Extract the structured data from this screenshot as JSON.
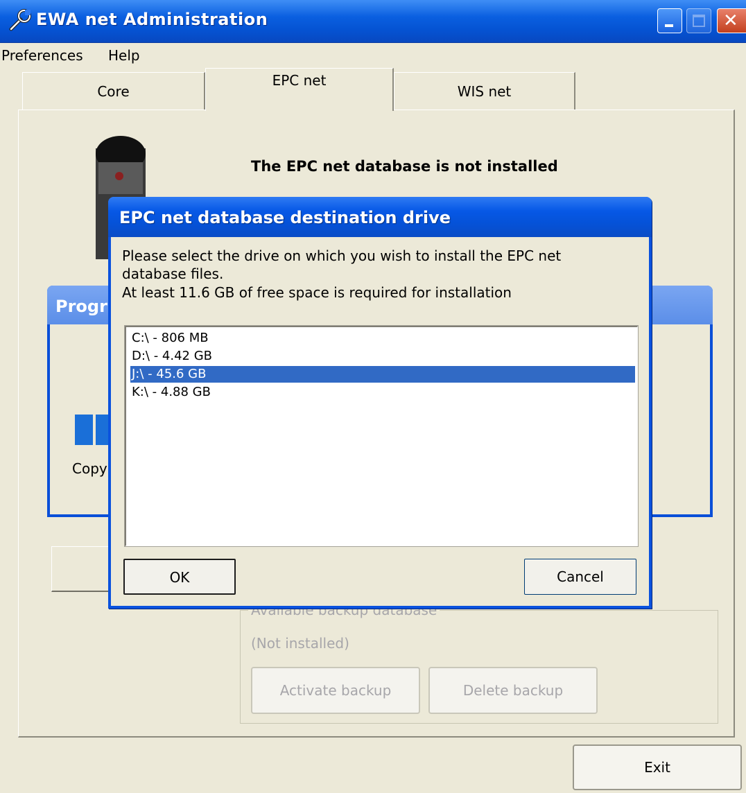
{
  "window": {
    "title": "EWA net Administration"
  },
  "menu": {
    "items": [
      "Preferences",
      "Help"
    ]
  },
  "tabs": [
    "Core",
    "EPC net",
    "WIS net"
  ],
  "epc": {
    "status": "The EPC net database is not installed"
  },
  "progress": {
    "title": "Progr",
    "copy_label": "Copy"
  },
  "backup": {
    "legend": "Available backup database",
    "status": "(Not installed)",
    "activate_label": "Activate backup",
    "delete_label": "Delete backup"
  },
  "exit_label": "Exit",
  "dialog": {
    "title": "EPC net database destination drive",
    "message": "Please select the drive on which you wish to install the EPC net database files.",
    "requirement": "At least 11.6 GB of free space is required for installation",
    "drives": [
      {
        "label": "C:\\ - 806 MB",
        "selected": false
      },
      {
        "label": "D:\\ - 4.42 GB",
        "selected": false
      },
      {
        "label": "J:\\ - 45.6 GB",
        "selected": true
      },
      {
        "label": "K:\\ - 4.88 GB",
        "selected": false
      }
    ],
    "ok_label": "OK",
    "cancel_label": "Cancel"
  },
  "colors": {
    "titlebar": "#0553d3",
    "selection": "#316ac5",
    "face": "#ece9d8"
  }
}
